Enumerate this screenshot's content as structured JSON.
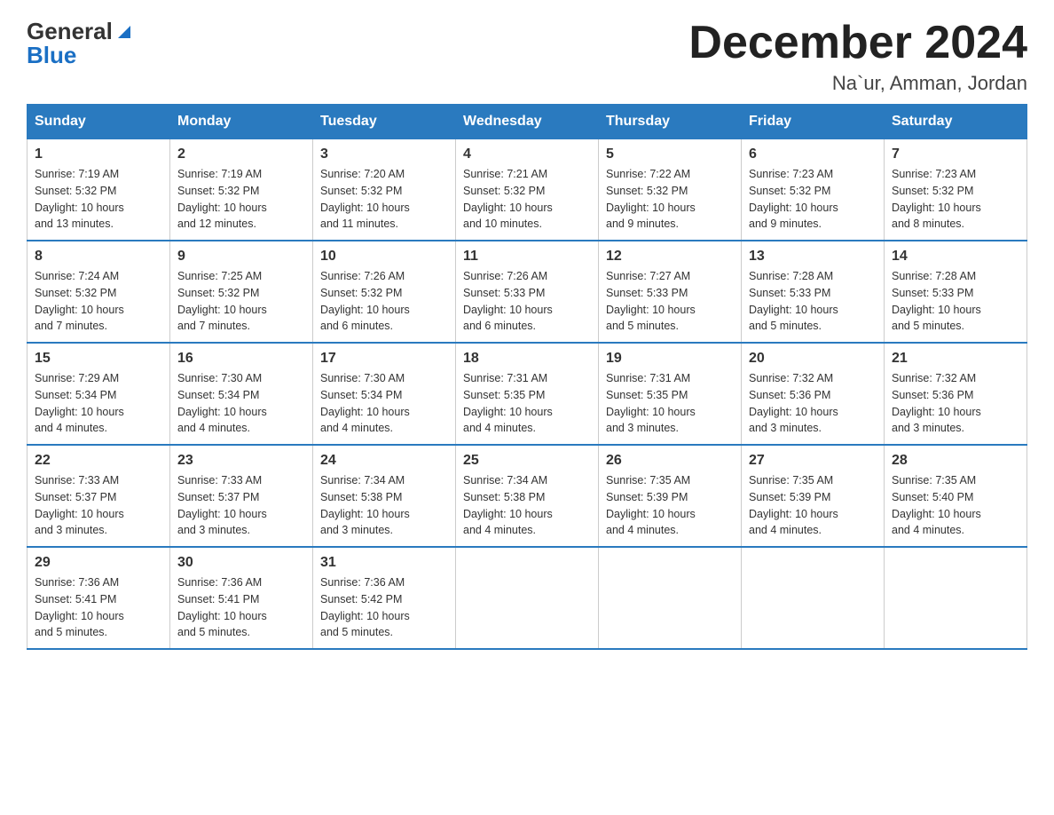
{
  "header": {
    "logo_general": "General",
    "logo_blue": "Blue",
    "title": "December 2024",
    "subtitle": "Na`ur, Amman, Jordan"
  },
  "days_of_week": [
    "Sunday",
    "Monday",
    "Tuesday",
    "Wednesday",
    "Thursday",
    "Friday",
    "Saturday"
  ],
  "weeks": [
    [
      {
        "day": "1",
        "sunrise": "7:19 AM",
        "sunset": "5:32 PM",
        "daylight": "10 hours and 13 minutes."
      },
      {
        "day": "2",
        "sunrise": "7:19 AM",
        "sunset": "5:32 PM",
        "daylight": "10 hours and 12 minutes."
      },
      {
        "day": "3",
        "sunrise": "7:20 AM",
        "sunset": "5:32 PM",
        "daylight": "10 hours and 11 minutes."
      },
      {
        "day": "4",
        "sunrise": "7:21 AM",
        "sunset": "5:32 PM",
        "daylight": "10 hours and 10 minutes."
      },
      {
        "day": "5",
        "sunrise": "7:22 AM",
        "sunset": "5:32 PM",
        "daylight": "10 hours and 9 minutes."
      },
      {
        "day": "6",
        "sunrise": "7:23 AM",
        "sunset": "5:32 PM",
        "daylight": "10 hours and 9 minutes."
      },
      {
        "day": "7",
        "sunrise": "7:23 AM",
        "sunset": "5:32 PM",
        "daylight": "10 hours and 8 minutes."
      }
    ],
    [
      {
        "day": "8",
        "sunrise": "7:24 AM",
        "sunset": "5:32 PM",
        "daylight": "10 hours and 7 minutes."
      },
      {
        "day": "9",
        "sunrise": "7:25 AM",
        "sunset": "5:32 PM",
        "daylight": "10 hours and 7 minutes."
      },
      {
        "day": "10",
        "sunrise": "7:26 AM",
        "sunset": "5:32 PM",
        "daylight": "10 hours and 6 minutes."
      },
      {
        "day": "11",
        "sunrise": "7:26 AM",
        "sunset": "5:33 PM",
        "daylight": "10 hours and 6 minutes."
      },
      {
        "day": "12",
        "sunrise": "7:27 AM",
        "sunset": "5:33 PM",
        "daylight": "10 hours and 5 minutes."
      },
      {
        "day": "13",
        "sunrise": "7:28 AM",
        "sunset": "5:33 PM",
        "daylight": "10 hours and 5 minutes."
      },
      {
        "day": "14",
        "sunrise": "7:28 AM",
        "sunset": "5:33 PM",
        "daylight": "10 hours and 5 minutes."
      }
    ],
    [
      {
        "day": "15",
        "sunrise": "7:29 AM",
        "sunset": "5:34 PM",
        "daylight": "10 hours and 4 minutes."
      },
      {
        "day": "16",
        "sunrise": "7:30 AM",
        "sunset": "5:34 PM",
        "daylight": "10 hours and 4 minutes."
      },
      {
        "day": "17",
        "sunrise": "7:30 AM",
        "sunset": "5:34 PM",
        "daylight": "10 hours and 4 minutes."
      },
      {
        "day": "18",
        "sunrise": "7:31 AM",
        "sunset": "5:35 PM",
        "daylight": "10 hours and 4 minutes."
      },
      {
        "day": "19",
        "sunrise": "7:31 AM",
        "sunset": "5:35 PM",
        "daylight": "10 hours and 3 minutes."
      },
      {
        "day": "20",
        "sunrise": "7:32 AM",
        "sunset": "5:36 PM",
        "daylight": "10 hours and 3 minutes."
      },
      {
        "day": "21",
        "sunrise": "7:32 AM",
        "sunset": "5:36 PM",
        "daylight": "10 hours and 3 minutes."
      }
    ],
    [
      {
        "day": "22",
        "sunrise": "7:33 AM",
        "sunset": "5:37 PM",
        "daylight": "10 hours and 3 minutes."
      },
      {
        "day": "23",
        "sunrise": "7:33 AM",
        "sunset": "5:37 PM",
        "daylight": "10 hours and 3 minutes."
      },
      {
        "day": "24",
        "sunrise": "7:34 AM",
        "sunset": "5:38 PM",
        "daylight": "10 hours and 3 minutes."
      },
      {
        "day": "25",
        "sunrise": "7:34 AM",
        "sunset": "5:38 PM",
        "daylight": "10 hours and 4 minutes."
      },
      {
        "day": "26",
        "sunrise": "7:35 AM",
        "sunset": "5:39 PM",
        "daylight": "10 hours and 4 minutes."
      },
      {
        "day": "27",
        "sunrise": "7:35 AM",
        "sunset": "5:39 PM",
        "daylight": "10 hours and 4 minutes."
      },
      {
        "day": "28",
        "sunrise": "7:35 AM",
        "sunset": "5:40 PM",
        "daylight": "10 hours and 4 minutes."
      }
    ],
    [
      {
        "day": "29",
        "sunrise": "7:36 AM",
        "sunset": "5:41 PM",
        "daylight": "10 hours and 5 minutes."
      },
      {
        "day": "30",
        "sunrise": "7:36 AM",
        "sunset": "5:41 PM",
        "daylight": "10 hours and 5 minutes."
      },
      {
        "day": "31",
        "sunrise": "7:36 AM",
        "sunset": "5:42 PM",
        "daylight": "10 hours and 5 minutes."
      },
      null,
      null,
      null,
      null
    ]
  ],
  "labels": {
    "sunrise": "Sunrise:",
    "sunset": "Sunset:",
    "daylight": "Daylight:"
  }
}
